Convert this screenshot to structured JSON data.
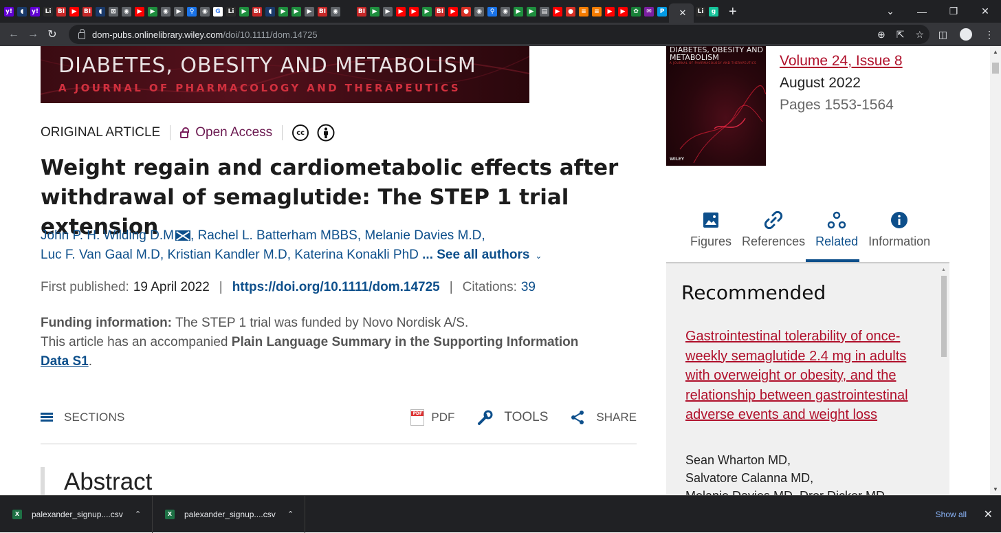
{
  "browser": {
    "active_tab_close": "✕",
    "new_tab": "+",
    "tabs": [
      {
        "icon": "yahoo-icon",
        "glyph": "y!",
        "bg": "#6001d2"
      },
      {
        "icon": "shield-icon",
        "glyph": "◖",
        "bg": "#1a3a6b"
      },
      {
        "icon": "yahoo-icon",
        "glyph": "y!",
        "bg": "#6001d2"
      },
      {
        "icon": "lili-icon",
        "glyph": "Li",
        "bg": "#2b2b2b"
      },
      {
        "icon": "bi-icon",
        "glyph": "BI",
        "bg": "#c62828"
      },
      {
        "icon": "youtube-icon",
        "glyph": "▶",
        "bg": "#ff0000"
      },
      {
        "icon": "bi-icon",
        "glyph": "BI",
        "bg": "#c62828"
      },
      {
        "icon": "shield-icon",
        "glyph": "◖",
        "bg": "#1a3a6b"
      },
      {
        "icon": "grid-icon",
        "glyph": "⊠",
        "bg": "#5f6368"
      },
      {
        "icon": "globe-icon",
        "glyph": "◉",
        "bg": "#5f6368"
      },
      {
        "icon": "youtube-icon",
        "glyph": "▶",
        "bg": "#ff0000"
      },
      {
        "icon": "play-icon",
        "glyph": "▶",
        "bg": "#1e8e3e"
      },
      {
        "icon": "globe-icon",
        "glyph": "◉",
        "bg": "#5f6368"
      },
      {
        "icon": "tag-icon",
        "glyph": "▶",
        "bg": "#5f6368"
      },
      {
        "icon": "search-icon",
        "glyph": "⚲",
        "bg": "#1a73e8"
      },
      {
        "icon": "globe-icon",
        "glyph": "◉",
        "bg": "#5f6368"
      },
      {
        "icon": "google-icon",
        "glyph": "G",
        "bg": "#ffffff"
      },
      {
        "icon": "lili-icon",
        "glyph": "Li",
        "bg": "#2b2b2b"
      },
      {
        "icon": "play-icon",
        "glyph": "▶",
        "bg": "#1e8e3e"
      },
      {
        "icon": "bi-icon",
        "glyph": "BI",
        "bg": "#c62828"
      },
      {
        "icon": "shield-icon",
        "glyph": "◖",
        "bg": "#1a3a6b"
      },
      {
        "icon": "play-icon",
        "glyph": "▶",
        "bg": "#1e8e3e"
      },
      {
        "icon": "play-icon",
        "glyph": "▶",
        "bg": "#1e8e3e"
      },
      {
        "icon": "tag-icon",
        "glyph": "▶",
        "bg": "#5f6368"
      },
      {
        "icon": "bi-icon",
        "glyph": "BI",
        "bg": "#c62828"
      },
      {
        "icon": "globe-icon",
        "glyph": "◉",
        "bg": "#5f6368"
      },
      {
        "icon": "blank-icon",
        "glyph": "",
        "bg": "#202124"
      },
      {
        "icon": "bi-icon",
        "glyph": "BI",
        "bg": "#c62828"
      },
      {
        "icon": "play-icon",
        "glyph": "▶",
        "bg": "#1e8e3e"
      },
      {
        "icon": "tag-icon",
        "glyph": "▶",
        "bg": "#5f6368"
      },
      {
        "icon": "youtube-icon",
        "glyph": "▶",
        "bg": "#ff0000"
      },
      {
        "icon": "youtube-icon",
        "glyph": "▶",
        "bg": "#ff0000"
      },
      {
        "icon": "play-icon",
        "glyph": "▶",
        "bg": "#1e8e3e"
      },
      {
        "icon": "bi-icon",
        "glyph": "BI",
        "bg": "#c62828"
      },
      {
        "icon": "youtube-icon",
        "glyph": "▶",
        "bg": "#ff0000"
      },
      {
        "icon": "mic-icon",
        "glyph": "●",
        "bg": "#d93025"
      },
      {
        "icon": "globe-icon",
        "glyph": "◉",
        "bg": "#5f6368"
      },
      {
        "icon": "search-icon",
        "glyph": "⚲",
        "bg": "#1a73e8"
      },
      {
        "icon": "globe-icon",
        "glyph": "◉",
        "bg": "#5f6368"
      },
      {
        "icon": "play-icon",
        "glyph": "▶",
        "bg": "#1e8e3e"
      },
      {
        "icon": "play-icon",
        "glyph": "▶",
        "bg": "#1e8e3e"
      },
      {
        "icon": "news-icon",
        "glyph": "▤",
        "bg": "#5f6368"
      },
      {
        "icon": "youtube-icon",
        "glyph": "▶",
        "bg": "#ff0000"
      },
      {
        "icon": "mic-icon",
        "glyph": "●",
        "bg": "#d93025"
      },
      {
        "icon": "stack-icon",
        "glyph": "≡",
        "bg": "#f57c00"
      },
      {
        "icon": "stack-icon",
        "glyph": "≡",
        "bg": "#f57c00"
      },
      {
        "icon": "youtube-icon",
        "glyph": "▶",
        "bg": "#ff0000"
      },
      {
        "icon": "youtube-icon",
        "glyph": "▶",
        "bg": "#ff0000"
      },
      {
        "icon": "leaf-icon",
        "glyph": "✿",
        "bg": "#188038"
      },
      {
        "icon": "yahoo-mail-icon",
        "glyph": "✉",
        "bg": "#7b1fa2"
      },
      {
        "icon": "p-icon",
        "glyph": "P",
        "bg": "#039be5"
      }
    ],
    "after_active": [
      {
        "icon": "lili-icon",
        "glyph": "Li",
        "bg": "#2b2b2b"
      },
      {
        "icon": "grammarly-icon",
        "glyph": "g",
        "bg": "#15c39a"
      }
    ],
    "window": {
      "dropdown": "⌄",
      "minimize": "—",
      "restore": "❐",
      "close": "✕"
    },
    "url_host": "dom-pubs.onlinelibrary.wiley.com",
    "url_path": "/doi/10.1111/dom.14725"
  },
  "journal": {
    "banner_title": "DIABETES, OBESITY AND METABOLISM",
    "banner_subtitle": "A JOURNAL OF PHARMACOLOGY AND THERAPEUTICS",
    "cover_title": "DIABETES, OBESITY AND METABOLISM",
    "cover_subtitle": "A JOURNAL OF PHARMACOLOGY AND THERAPEUTICS",
    "cover_publisher": "WILEY",
    "volume_label": "Volume 24, Issue 8",
    "issue_date": "August 2022",
    "pages": "Pages 1553-1564"
  },
  "article": {
    "type": "ORIGINAL ARTICLE",
    "access": "Open Access",
    "cc_label": "cc",
    "title": "Weight regain and cardiometabolic effects after withdrawal of semaglutide: The STEP 1 trial extension",
    "authors_line1": [
      "John P. H. Wilding D.M",
      "Rachel L. Batterham MBBS",
      "Melanie Davies M.D"
    ],
    "authors_line2": [
      "Luc F. Van Gaal M.D",
      "Kristian Kandler M.D",
      "Katerina Konakli PhD"
    ],
    "see_all": "... See all authors",
    "first_published_label": "First published:",
    "first_published": "19 April 2022",
    "doi": "https://doi.org/10.1111/dom.14725",
    "citations_label": "Citations:",
    "citations": "39",
    "funding_label": "Funding information:",
    "funding_text": "The STEP 1 trial was funded by Novo Nordisk A/S.",
    "pls_prefix": "This article has an accompanied",
    "pls_bold": "Plain Language Summary in the Supporting Information",
    "pls_link": "Data S1",
    "pls_suffix": ".",
    "abstract_heading": "Abstract"
  },
  "actions": {
    "sections": "SECTIONS",
    "pdf": "PDF",
    "tools": "TOOLS",
    "share": "SHARE"
  },
  "sidebar": {
    "tabs": [
      {
        "label": "Figures",
        "icon": "image-icon"
      },
      {
        "label": "References",
        "icon": "link-icon"
      },
      {
        "label": "Related",
        "icon": "related-icon"
      },
      {
        "label": "Information",
        "icon": "info-icon"
      }
    ],
    "selected_tab": "Related",
    "recommended_heading": "Recommended",
    "rec_title": "Gastrointestinal tolerability of once-weekly semaglutide 2.4 mg in adults with overweight or obesity, and the relationship between gastrointestinal adverse events and weight loss",
    "rec_authors": [
      "Sean Wharton MD,",
      "Salvatore Calanna MD,",
      "Melanie Davies MD, Dror Dicker MD,"
    ]
  },
  "downloads": {
    "items": [
      {
        "name": "palexander_signup....csv",
        "icon": "excel-icon",
        "glyph": "X"
      },
      {
        "name": "palexander_signup....csv",
        "icon": "excel-icon",
        "glyph": "X"
      }
    ],
    "show_all": "Show all",
    "close": "✕"
  },
  "colors": {
    "link_blue": "#0d4f8b",
    "wiley_red": "#b0102b",
    "open_access_purple": "#6b1950"
  }
}
